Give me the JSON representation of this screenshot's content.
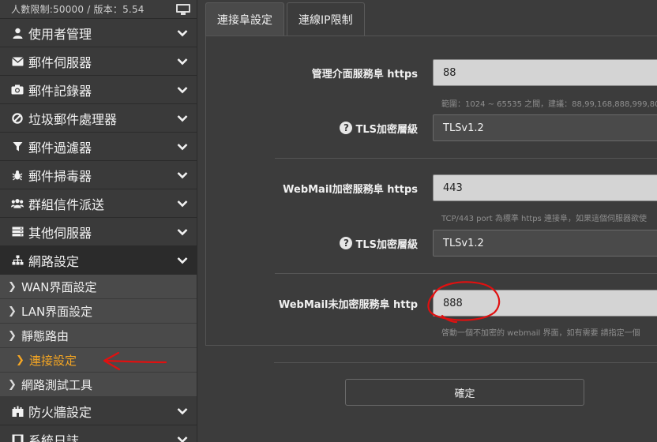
{
  "header": {
    "info": "人數限制:50000 / 版本：5.54",
    "monitor_icon": "monitor-icon"
  },
  "sidebar": {
    "items": [
      {
        "label": "使用者管理",
        "icon": "user-icon"
      },
      {
        "label": "郵件伺服器",
        "icon": "envelope-icon"
      },
      {
        "label": "郵件記錄器",
        "icon": "camera-icon"
      },
      {
        "label": "垃圾郵件處理器",
        "icon": "ban-icon"
      },
      {
        "label": "郵件過濾器",
        "icon": "filter-icon"
      },
      {
        "label": "郵件掃毒器",
        "icon": "bug-icon"
      },
      {
        "label": "群組信件派送",
        "icon": "users-icon"
      },
      {
        "label": "其他伺服器",
        "icon": "server-icon"
      },
      {
        "label": "網路設定",
        "icon": "sitemap-icon"
      }
    ],
    "subitems": [
      {
        "label": "WAN界面設定"
      },
      {
        "label": "LAN界面設定"
      },
      {
        "label": "靜態路由"
      },
      {
        "label": "連接設定"
      },
      {
        "label": "網路測試工具"
      }
    ],
    "items_after": [
      {
        "label": "防火牆設定",
        "icon": "castle-icon"
      },
      {
        "label": "系統日誌",
        "icon": "film-icon"
      }
    ]
  },
  "tabs": [
    {
      "label": "連接阜設定"
    },
    {
      "label": "連線IP限制"
    }
  ],
  "form": {
    "https_port_label": "管理介面服務阜 https",
    "https_port_value": "88",
    "https_port_hint": "範圍：1024 ~ 65535 之間，建議：88,99,168,888,999,80",
    "tls1_label": "TLS加密層級",
    "tls1_value": "TLSv1.2",
    "webmail_https_label": "WebMail加密服務阜 https",
    "webmail_https_value": "443",
    "webmail_https_hint": "TCP/443 port 為標準 https 連接阜，如果這個伺服器欲使",
    "tls2_label": "TLS加密層級",
    "tls2_value": "TLSv1.2",
    "webmail_http_label": "WebMail未加密服務阜 http",
    "webmail_http_value": "888",
    "webmail_http_hint": "啓動一個不加密的 webmail 界面，如有需要 請指定一個",
    "confirm_label": "確定"
  },
  "colors": {
    "active_sub": "#f5a623",
    "annotation": "#e01010"
  }
}
